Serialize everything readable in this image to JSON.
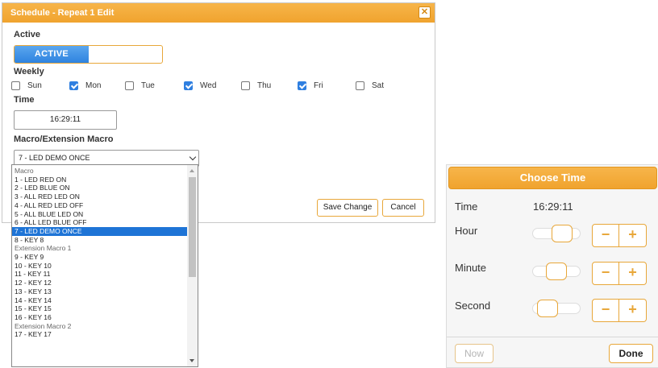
{
  "dialog": {
    "title": "Schedule - Repeat 1 Edit",
    "close_icon": "close-icon",
    "active_label": "Active",
    "active_toggle": "ACTIVE",
    "weekly_label": "Weekly",
    "days": [
      {
        "label": "Sun",
        "checked": false
      },
      {
        "label": "Mon",
        "checked": true
      },
      {
        "label": "Tue",
        "checked": false
      },
      {
        "label": "Wed",
        "checked": true
      },
      {
        "label": "Thu",
        "checked": false
      },
      {
        "label": "Fri",
        "checked": true
      },
      {
        "label": "Sat",
        "checked": false
      }
    ],
    "time_label": "Time",
    "time_value": "16:29:11",
    "macro_label": "Macro/Extension Macro",
    "macro_selected": "7 - LED DEMO ONCE",
    "save_button": "Save Change",
    "cancel_button": "Cancel"
  },
  "dropdown": {
    "items": [
      {
        "text": "Macro",
        "type": "group"
      },
      {
        "text": "1 - LED RED ON",
        "type": "option"
      },
      {
        "text": "2 - LED BLUE ON",
        "type": "option"
      },
      {
        "text": "3 - ALL RED LED ON",
        "type": "option"
      },
      {
        "text": "4 - ALL RED LED OFF",
        "type": "option"
      },
      {
        "text": "5 - ALL BLUE LED ON",
        "type": "option"
      },
      {
        "text": "6 - ALL LED BLUE OFF",
        "type": "option"
      },
      {
        "text": "7 - LED DEMO ONCE",
        "type": "selected"
      },
      {
        "text": "8 - KEY 8",
        "type": "option"
      },
      {
        "text": "Extension Macro 1",
        "type": "group"
      },
      {
        "text": "9 - KEY 9",
        "type": "option"
      },
      {
        "text": "10 - KEY 10",
        "type": "option"
      },
      {
        "text": "11 - KEY 11",
        "type": "option"
      },
      {
        "text": "12 - KEY 12",
        "type": "option"
      },
      {
        "text": "13 - KEY 13",
        "type": "option"
      },
      {
        "text": "14 - KEY 14",
        "type": "option"
      },
      {
        "text": "15 - KEY 15",
        "type": "option"
      },
      {
        "text": "16 - KEY 16",
        "type": "option"
      },
      {
        "text": "Extension Macro 2",
        "type": "group"
      },
      {
        "text": "17 - KEY 17",
        "type": "option"
      }
    ]
  },
  "time_picker": {
    "title": "Choose Time",
    "time_label": "Time",
    "time_value": "16:29:11",
    "hour_label": "Hour",
    "hour_value": 16,
    "minute_label": "Minute",
    "minute_value": 29,
    "second_label": "Second",
    "second_value": 11,
    "minus": "−",
    "plus": "+",
    "now_button": "Now",
    "done_button": "Done"
  },
  "colors": {
    "accent": "#f0a32e",
    "toggle_active": "#2f83df",
    "selected_row": "#1e74d6"
  }
}
